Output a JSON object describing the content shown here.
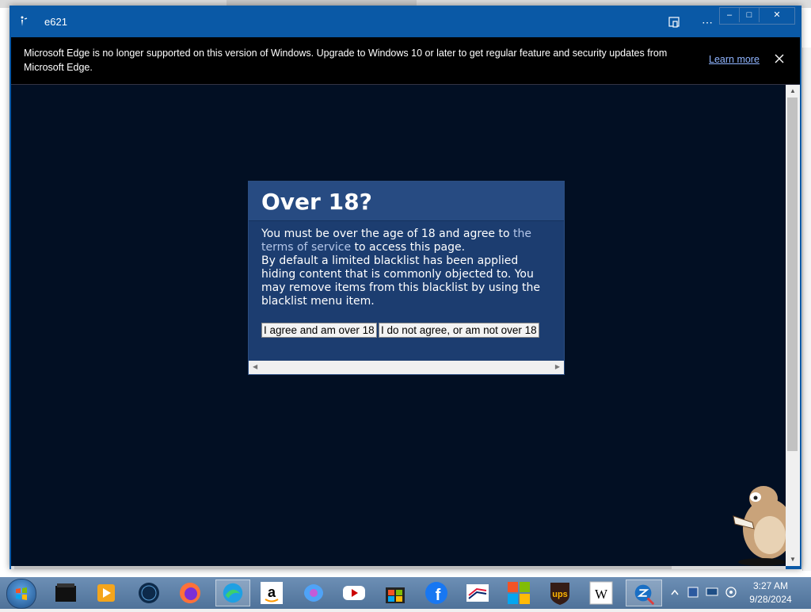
{
  "window": {
    "title": "e621"
  },
  "infobar": {
    "message": "Microsoft Edge is no longer supported on this version of Windows. Upgrade to Windows 10 or later to get regular feature and security updates from Microsoft Edge.",
    "learn_more": "Learn more"
  },
  "dialog": {
    "title": "Over 18?",
    "text_before_link": "You must be over the age of 18 and agree to ",
    "link": "the terms of service",
    "text_after_link": " to access this page.",
    "paragraph2": "By default a limited blacklist has been applied hiding content that is commonly objected to. You may remove items from this blacklist by using the blacklist menu item.",
    "agree_button": "I agree and am over 18",
    "disagree_button": "I do not agree, or am not over 18"
  },
  "taskbar": {
    "apps": [
      "terminal-app-icon",
      "media-player-icon",
      "globe-app-icon",
      "firefox-icon",
      "edge-icon",
      "amazon-icon",
      "copilot-icon",
      "youtube-icon",
      "store-bag-icon",
      "facebook-icon",
      "bank-of-america-icon",
      "microsoft-icon",
      "ups-icon",
      "wikipedia-icon",
      "e621-app-icon"
    ],
    "ups_label": "ups",
    "wiki_label": "W",
    "time": "3:27 AM",
    "date": "9/28/2024"
  },
  "colors": {
    "titlebar": "#0a59a6",
    "page_bg": "#020f23",
    "dialog_bg": "#1c3d70",
    "dialog_head": "#274b82"
  }
}
